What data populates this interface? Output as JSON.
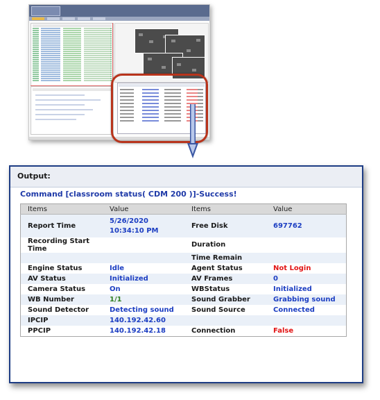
{
  "output_panel": {
    "title": "Output:",
    "command": "Command [classroom status( CDM 200 )]-Success!",
    "headers": [
      "Items",
      "Value",
      "Items",
      "Value"
    ],
    "rows": [
      {
        "l1": "Report Time",
        "v1": "5/26/2020 10:34:10 PM",
        "l2": "Free Disk",
        "v2": "697762"
      },
      {
        "l1": "Recording Start Time",
        "v1": "",
        "l2": "Duration",
        "v2": ""
      },
      {
        "l1": "",
        "v1": "",
        "l2": "Time Remain",
        "v2": ""
      },
      {
        "l1": "Engine Status",
        "v1": "Idle",
        "l2": "Agent Status",
        "v2": "Not Login"
      },
      {
        "l1": "AV Status",
        "v1": "Initialized",
        "l2": "AV Frames",
        "v2": "0"
      },
      {
        "l1": "Camera Status",
        "v1": "On",
        "l2": "WBStatus",
        "v2": "Initialized"
      },
      {
        "l1": "WB Number",
        "v1": "1/1",
        "l2": "Sound Grabber",
        "v2": "Grabbing sound"
      },
      {
        "l1": "Sound Detector",
        "v1": "Detecting sound",
        "l2": "Sound Source",
        "v2": "Connected"
      },
      {
        "l1": "IPCIP",
        "v1": "140.192.42.60",
        "l2": "",
        "v2": ""
      },
      {
        "l1": "PPCIP",
        "v1": "140.192.42.18",
        "l2": "Connection",
        "v2": "False"
      }
    ]
  },
  "colors": {
    "value_blue": "#1c3ec2",
    "value_red": "#e21414",
    "value_green": "#2e7d1e",
    "panel_border": "#1d3c84",
    "highlight_red": "#b8341c"
  },
  "icons": [
    "down-arrow-icon"
  ]
}
